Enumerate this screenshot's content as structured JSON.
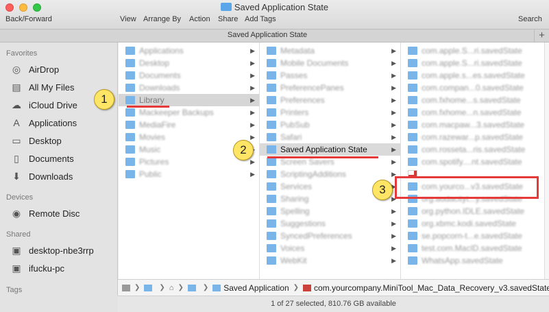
{
  "window": {
    "title": "Saved Application State",
    "tab_title": "Saved Application State"
  },
  "toolbar": {
    "back_forward": "Back/Forward",
    "view": "View",
    "arrange_by": "Arrange By",
    "action": "Action",
    "share": "Share",
    "add_tags": "Add Tags",
    "search": "Search",
    "new_tab": "+"
  },
  "sidebar": {
    "favorites_header": "Favorites",
    "favorites": [
      {
        "label": "AirDrop",
        "icon": "airdrop-icon"
      },
      {
        "label": "All My Files",
        "icon": "all-files-icon"
      },
      {
        "label": "iCloud Drive",
        "icon": "cloud-icon"
      },
      {
        "label": "Applications",
        "icon": "applications-icon"
      },
      {
        "label": "Desktop",
        "icon": "desktop-icon"
      },
      {
        "label": "Documents",
        "icon": "documents-icon"
      },
      {
        "label": "Downloads",
        "icon": "downloads-icon"
      }
    ],
    "devices_header": "Devices",
    "devices": [
      {
        "label": "Remote Disc",
        "icon": "disc-icon"
      }
    ],
    "shared_header": "Shared",
    "shared": [
      {
        "label": "desktop-nbe3rrp",
        "icon": "computer-icon"
      },
      {
        "label": "ifucku-pc",
        "icon": "computer-icon"
      }
    ],
    "tags_header": "Tags"
  },
  "columns": {
    "col1": [
      "Applications",
      "Desktop",
      "Documents",
      "Downloads",
      "Library",
      "Mackeeper Backups",
      "MediaFire",
      "Movies",
      "Music",
      "Pictures",
      "Public"
    ],
    "col1_selected": "Library",
    "col2": [
      "Metadata",
      "Mobile Documents",
      "Passes",
      "PreferencePanes",
      "Preferences",
      "Printers",
      "PubSub",
      "Safari",
      "Saved Application State",
      "Screen Savers",
      "ScriptingAdditions",
      "Services",
      "Sharing",
      "Spelling",
      "Suggestions",
      "SyncedPreferences",
      "Voices",
      "WebKit"
    ],
    "col2_selected": "Saved Application State",
    "col3": [
      "com.apple.S...ri.savedState",
      "com.apple.S...ri.savedState",
      "com.apple.s...es.savedState",
      "com.compan...0.savedState",
      "com.fxhome...s.savedState",
      "com.fxhome...n.savedState",
      "com.macpaw...3.savedState",
      "com.razewar...p.savedState",
      "com.rosseta...ris.savedState",
      "com.spotify....nt.savedState",
      "com.yourco...v3.savedState",
      "com.yourco...v3.savedState",
      "org.audacityt...y.savedState",
      "org.python.IDLE.savedState",
      "org.xbmc.kodi.savedState",
      "se.popcorn-t...e.savedState",
      "test.com.MacID.savedState",
      "WhatsApp.savedState"
    ],
    "col3_selected": "com.yourco...v3.savedState"
  },
  "pathbar": {
    "items": [
      "Saved Application State",
      "com.yourcompany.MiniTool_Mac_Data_Recovery_v3.savedState"
    ],
    "saved_label": "Saved Application"
  },
  "status": {
    "text": "1 of 27 selected, 810.76 GB available"
  },
  "annotations": {
    "step1": "1",
    "step2": "2",
    "step3": "3"
  },
  "colors": {
    "selection_blue": "#1f63d6",
    "annotation_red": "#e63a3a",
    "badge_yellow": "#ffe566"
  }
}
